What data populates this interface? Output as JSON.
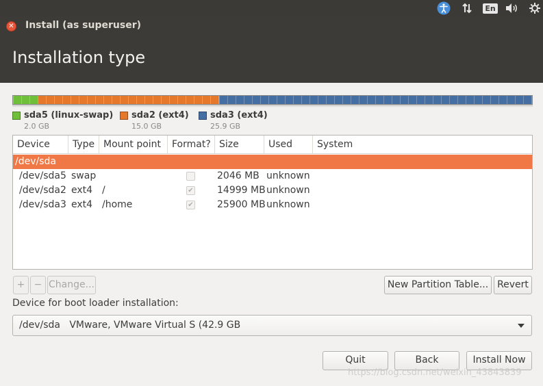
{
  "system_panel": {
    "icons": [
      "accessibility-icon",
      "network-icon",
      "keyboard-layout-icon",
      "volume-icon",
      "settings-gear-icon"
    ],
    "keyboard_layout": "En"
  },
  "window": {
    "title": "Install (as superuser)"
  },
  "page": {
    "title": "Installation type"
  },
  "partition_bar": {
    "segments": [
      {
        "name": "sda5 (linux-swap)",
        "size": "2.0 GB",
        "fraction": 0.047,
        "color": "#6fbf3b"
      },
      {
        "name": "sda2 (ext4)",
        "size": "15.0 GB",
        "fraction": 0.35,
        "color": "#e5782a"
      },
      {
        "name": "sda3 (ext4)",
        "size": "25.9 GB",
        "fraction": 0.603,
        "color": "#456ea3"
      }
    ]
  },
  "table": {
    "headers": [
      "Device",
      "Type",
      "Mount point",
      "Format?",
      "Size",
      "Used",
      "System"
    ],
    "rows": [
      {
        "device": "/dev/sda",
        "type": "",
        "mount": "",
        "format": null,
        "size": "",
        "used": "",
        "system": "",
        "selected": true
      },
      {
        "device": "/dev/sda5",
        "type": "swap",
        "mount": "",
        "format": false,
        "size": "2046 MB",
        "used": "unknown",
        "system": "",
        "selected": false
      },
      {
        "device": "/dev/sda2",
        "type": "ext4",
        "mount": "/",
        "format": true,
        "size": "14999 MB",
        "used": "unknown",
        "system": "",
        "selected": false
      },
      {
        "device": "/dev/sda3",
        "type": "ext4",
        "mount": "/home",
        "format": true,
        "size": "25900 MB",
        "used": "unknown",
        "system": "",
        "selected": false
      }
    ]
  },
  "partition_actions": {
    "add_label": "+",
    "remove_label": "−",
    "change_label": "Change...",
    "new_table_label": "New Partition Table...",
    "revert_label": "Revert"
  },
  "boot_loader": {
    "label": "Device for boot loader installation:",
    "selected_value": "/dev/sda   VMware, VMware Virtual S (42.9 GB"
  },
  "footer": {
    "quit_label": "Quit",
    "back_label": "Back",
    "install_label": "Install Now"
  },
  "watermark": "https://blog.csdn.net/weixin_43843839"
}
